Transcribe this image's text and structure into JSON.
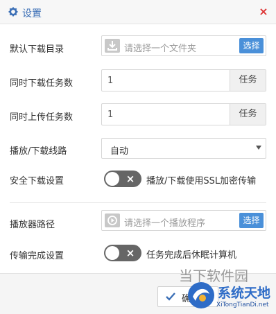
{
  "dialog": {
    "title": "设置",
    "close_symbol": "×"
  },
  "download_dir": {
    "label": "默认下载目录",
    "placeholder": "请选择一个文件夹",
    "button": "选择"
  },
  "concurrent_download": {
    "label": "同时下载任务数",
    "value": "1",
    "unit": "任务"
  },
  "concurrent_upload": {
    "label": "同时上传任务数",
    "value": "1",
    "unit": "任务"
  },
  "playback_line": {
    "label": "播放/下载线路",
    "selected": "自动"
  },
  "secure_download": {
    "label": "安全下载设置",
    "toggle_on": false,
    "toggle_symbol": "×",
    "description": "播放/下载使用SSL加密传输"
  },
  "player_path": {
    "label": "播放器路径",
    "placeholder": "请选择一个播放程序",
    "button": "选择"
  },
  "after_transfer": {
    "label": "传输完成设置",
    "toggle_on": false,
    "toggle_symbol": "×",
    "description": "任务完成后休眠计算机"
  },
  "footer": {
    "ok_label": "确定"
  },
  "watermark": {
    "line1": "当下软件园",
    "line2": "系统天地",
    "line3": "XiTongTianDi.net"
  },
  "colors": {
    "accent": "#4a90d9",
    "title": "#3b6fb6",
    "close": "#dd3333",
    "toggle_off": "#666666"
  }
}
